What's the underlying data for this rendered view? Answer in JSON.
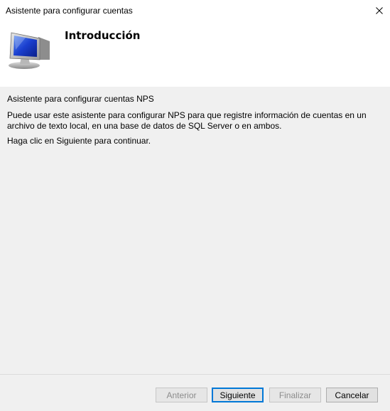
{
  "window": {
    "title": "Asistente para configurar cuentas"
  },
  "header": {
    "heading": "Introducción",
    "icon": "monitor-icon"
  },
  "content": {
    "paragraph1": "Asistente para configurar cuentas NPS",
    "paragraph2": "Puede usar este asistente para configurar NPS para que registre información de cuentas en un archivo de texto local, en una base de datos de SQL Server o en ambos.",
    "paragraph3": "Haga clic en Siguiente para continuar."
  },
  "buttons": {
    "back": "Anterior",
    "next": "Siguiente",
    "finish": "Finalizar",
    "cancel": "Cancelar"
  },
  "colors": {
    "content_background": "#f0f0f0",
    "default_button_border": "#0078d7",
    "disabled_text": "#8c8c8c"
  }
}
